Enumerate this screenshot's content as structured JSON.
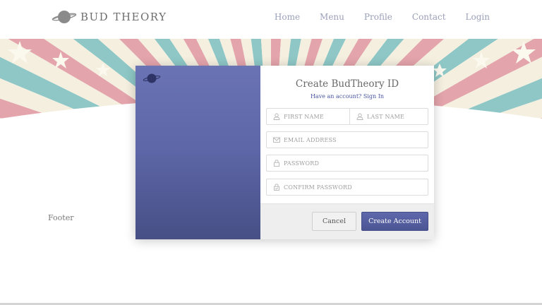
{
  "header": {
    "logo_text": "BUD THEORY",
    "nav": [
      {
        "label": "Home"
      },
      {
        "label": "Menu"
      },
      {
        "label": "Profile"
      },
      {
        "label": "Contact"
      },
      {
        "label": "Login"
      }
    ]
  },
  "modal": {
    "title": "Create BudTheory ID",
    "subtitle_prefix": "Have an account?",
    "subtitle_link": "Sign In",
    "fields": {
      "first_name": {
        "placeholder": "FIRST NAME",
        "icon": "user-icon"
      },
      "last_name": {
        "placeholder": "LAST NAME",
        "icon": "user-icon"
      },
      "email": {
        "placeholder": "EMAIL ADDRESS",
        "icon": "envelope-icon"
      },
      "password": {
        "placeholder": "PASSWORD",
        "icon": "lock-icon"
      },
      "confirm_password": {
        "placeholder": "CONFIRM PASSWORD",
        "icon": "lock-check-icon"
      }
    },
    "cancel_label": "Cancel",
    "create_label": "Create Account"
  },
  "footer": {
    "text": "Footer"
  },
  "colors": {
    "accent": "#5a63a6",
    "nav_text": "#9aa0b8",
    "banner_red": "#e3a4ab",
    "banner_teal": "#8ec7c6",
    "banner_cream": "#f4efdf"
  }
}
